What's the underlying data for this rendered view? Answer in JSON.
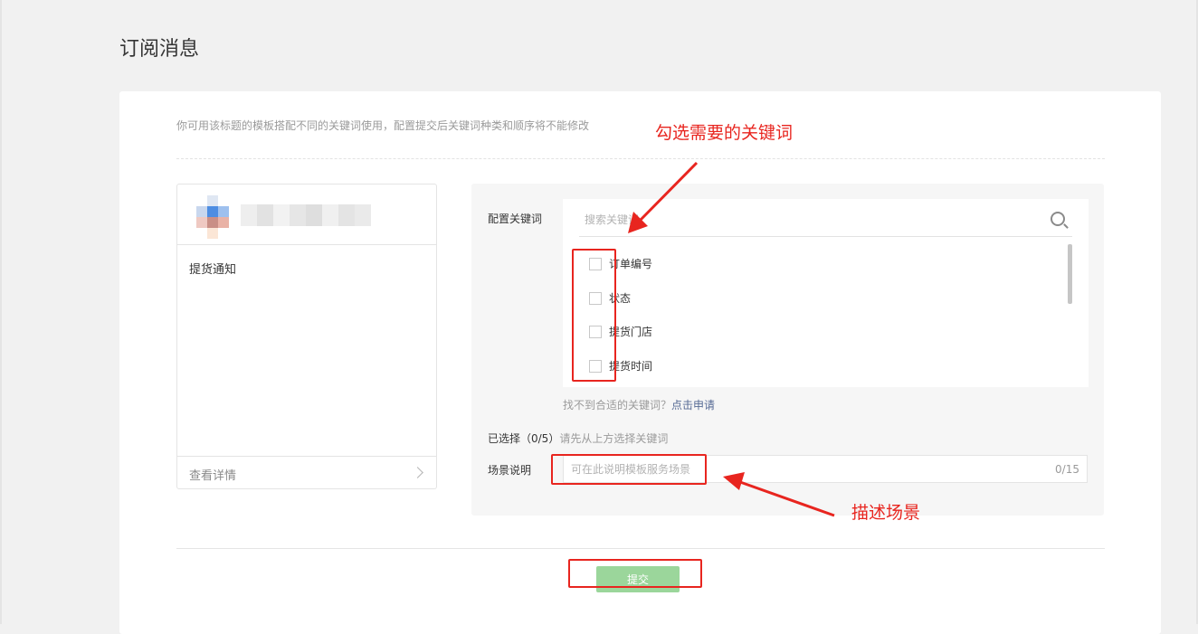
{
  "page": {
    "title": "订阅消息"
  },
  "hint": "你可用该标题的模板搭配不同的关键词使用，配置提交后关键词种类和顺序将不能修改",
  "preview": {
    "template_title": "提货通知",
    "detail_label": "查看详情"
  },
  "config": {
    "label": "配置关键词",
    "search_placeholder": "搜索关键词",
    "keywords": [
      {
        "label": "订单编号",
        "checked": false
      },
      {
        "label": "状态",
        "checked": false
      },
      {
        "label": "提货门店",
        "checked": false
      },
      {
        "label": "提货时间",
        "checked": false
      }
    ],
    "not_found": "找不到合适的关键词？",
    "apply_link": "点击申请",
    "selected": "已选择（0/5）",
    "selected_hint": "请先从上方选择关键词",
    "scene_label": "场景说明",
    "scene_placeholder": "可在此说明模板服务场景",
    "scene_counter": "0/15"
  },
  "submit_label": "提交",
  "annotations": {
    "select_keywords": "勾选需要的关键词",
    "describe_scene": "描述场景",
    "color": "#e8251f"
  }
}
